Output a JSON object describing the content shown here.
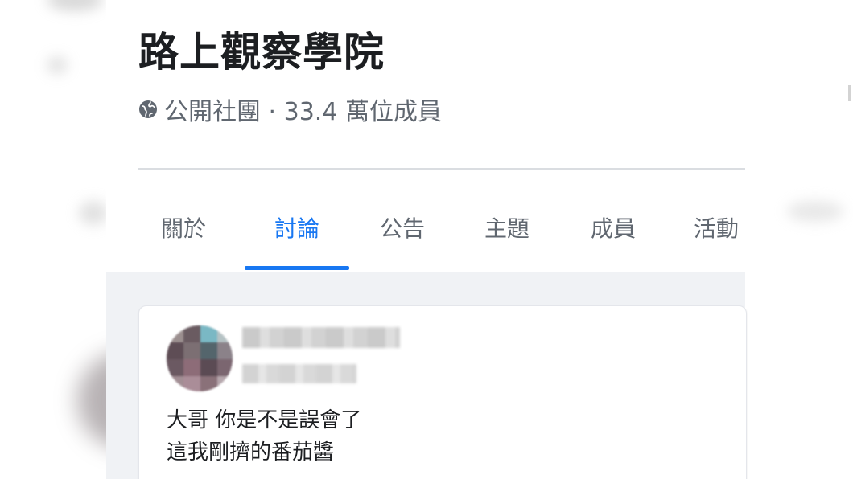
{
  "group": {
    "name": "路上觀察學院",
    "privacy_icon": "globe-icon",
    "meta": "公開社團 · 33.4 萬位成員"
  },
  "tabs": [
    {
      "label": "關於",
      "active": false
    },
    {
      "label": "討論",
      "active": true
    },
    {
      "label": "公告",
      "active": false
    },
    {
      "label": "主題",
      "active": false
    },
    {
      "label": "成員",
      "active": false
    },
    {
      "label": "活動",
      "active": false
    }
  ],
  "post": {
    "line1": "大哥 你是不是誤會了",
    "line2": "這我剛擠的番茄醬"
  },
  "colors": {
    "accent": "#1877f2",
    "text_primary": "#1c1e21",
    "text_secondary": "#606770",
    "feed_bg": "#f0f2f5"
  }
}
